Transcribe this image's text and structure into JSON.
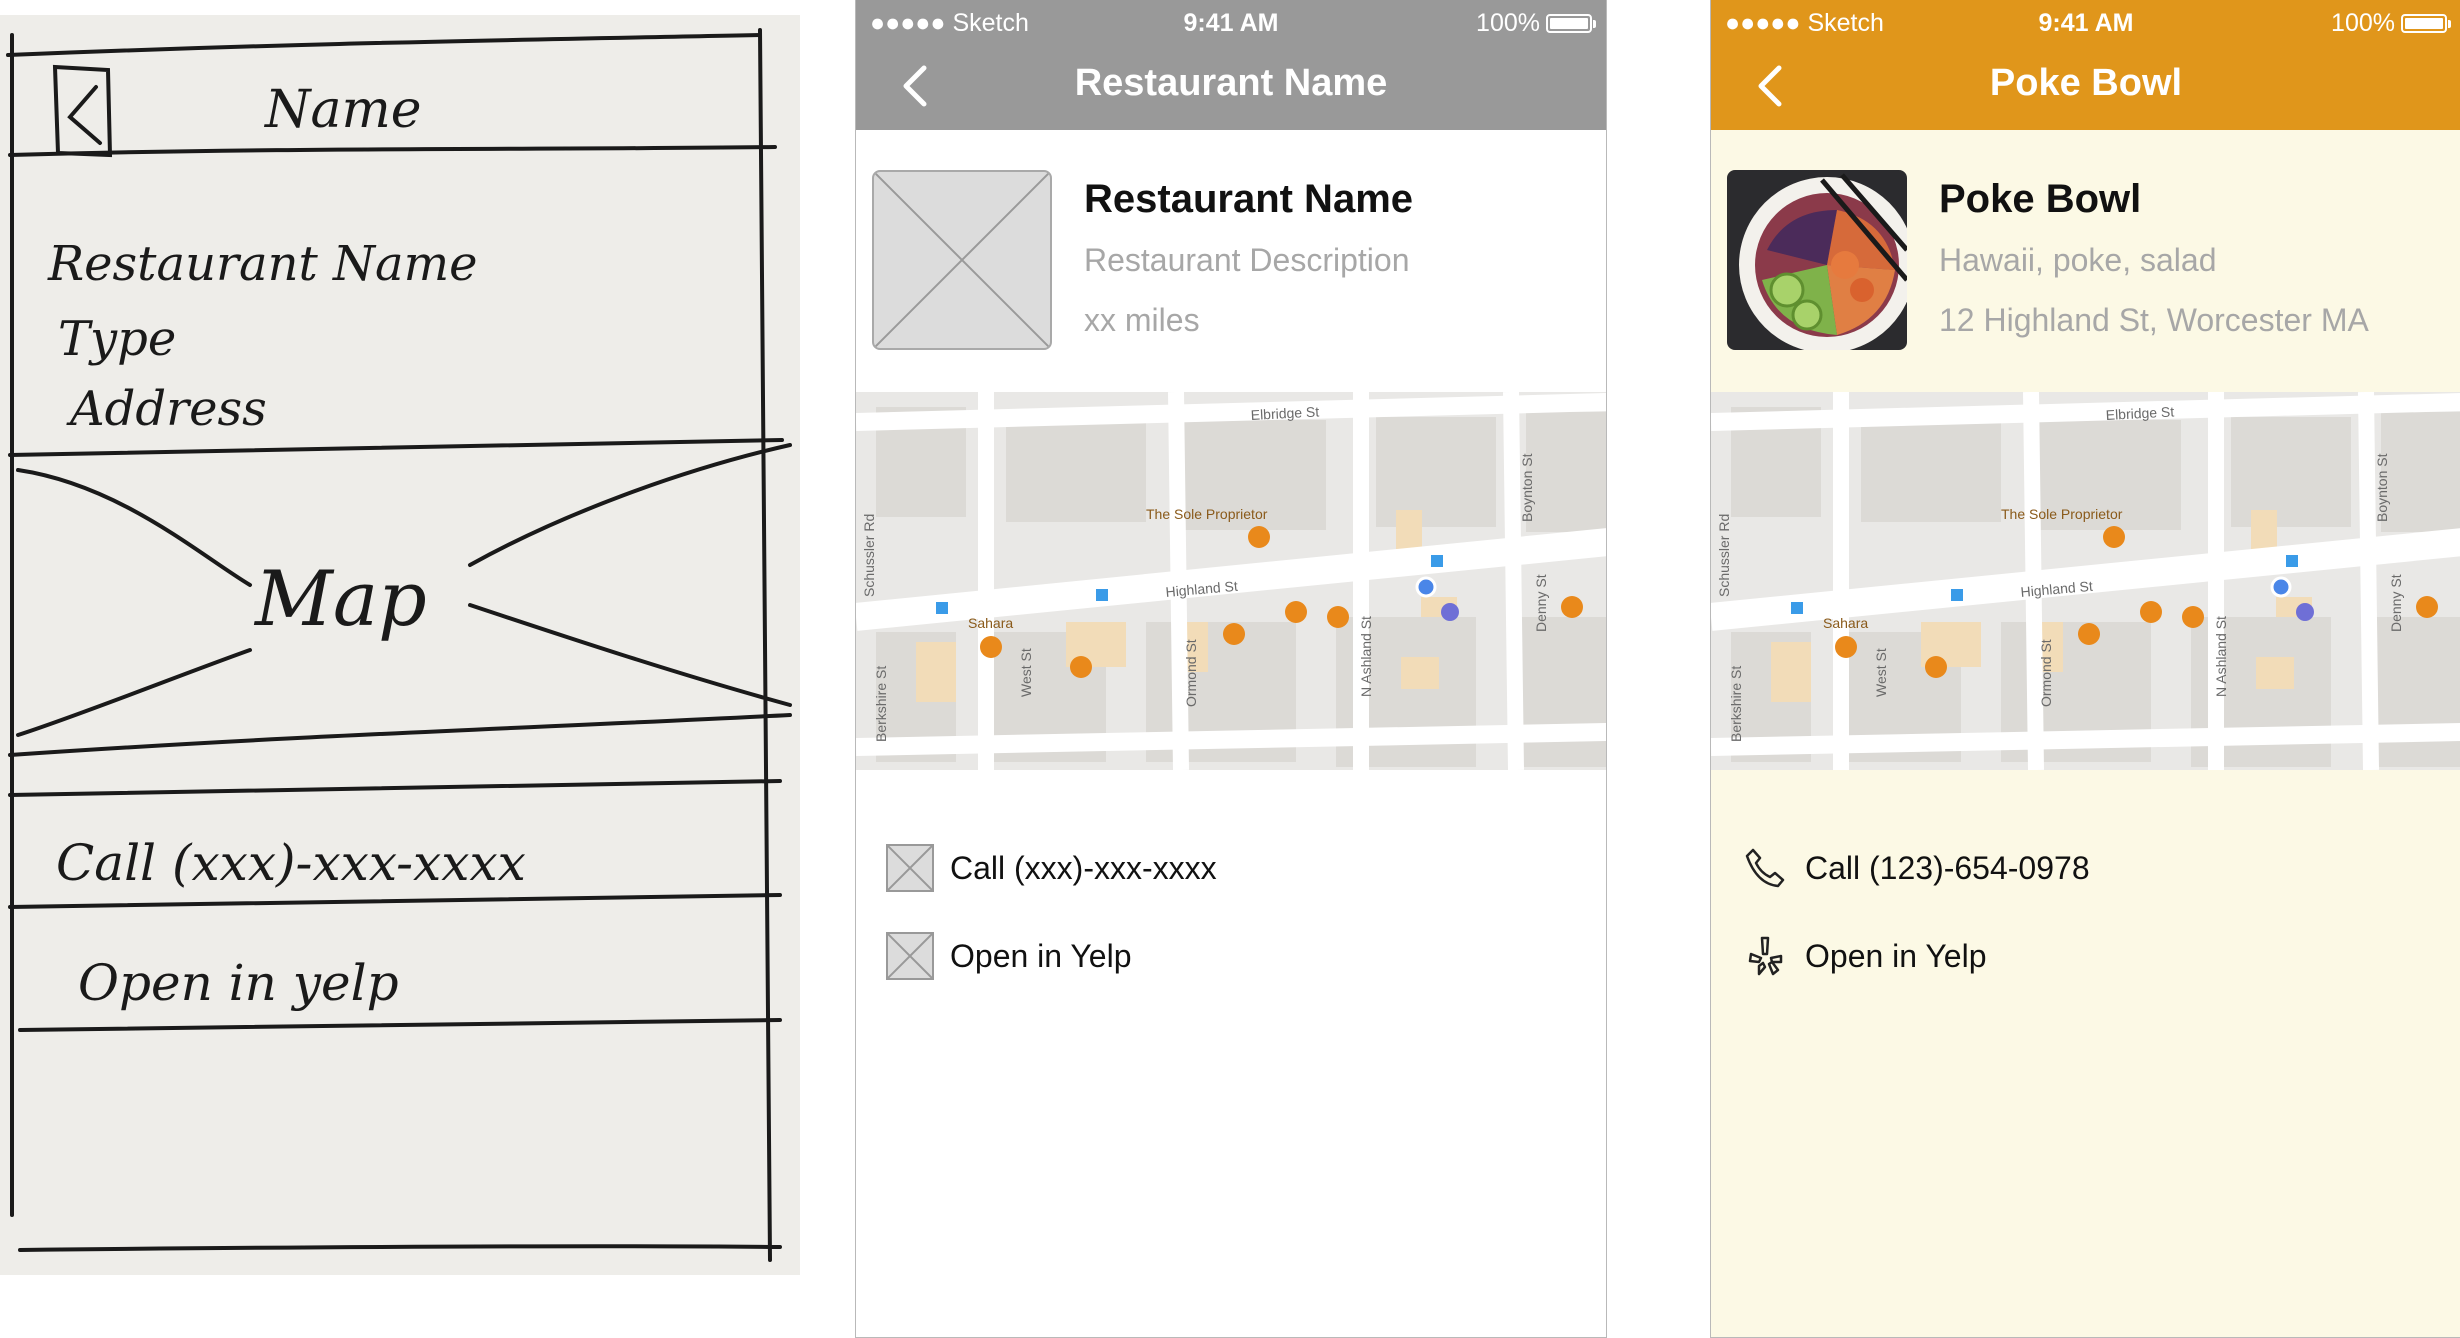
{
  "sketch": {
    "title": "Name",
    "header_lines": [
      "Restaurant Name",
      "Type",
      "Address"
    ],
    "map_label": "Map",
    "call_label": "Call (xxx)-xxx-xxxx",
    "yelp_label": "Open in yelp"
  },
  "wireframe": {
    "status": {
      "carrier": "●●●●● Sketch",
      "time": "9:41 AM",
      "battery": "100%"
    },
    "nav_title": "Restaurant Name",
    "name": "Restaurant Name",
    "description": "Restaurant Description",
    "distance": "xx miles",
    "call_label": "Call (xxx)-xxx-xxxx",
    "yelp_label": "Open in Yelp",
    "icons": {
      "back": "chevron-left-icon",
      "thumb": "image-placeholder-icon",
      "call": "placeholder-icon",
      "yelp": "placeholder-icon"
    },
    "colors": {
      "navbar": "#999999",
      "background": "#ffffff"
    }
  },
  "final": {
    "status": {
      "carrier": "●●●●● Sketch",
      "time": "9:41 AM",
      "battery": "100%"
    },
    "nav_title": "Poke Bowl",
    "name": "Poke Bowl",
    "tags": "Hawaii, poke, salad",
    "address": "12 Highland St, Worcester MA",
    "call_label": "Call (123)-654-0978",
    "yelp_label": "Open in Yelp",
    "icons": {
      "back": "chevron-left-icon",
      "call": "phone-icon",
      "yelp": "yelp-icon"
    },
    "colors": {
      "navbar": "#e0961b",
      "background": "#fcf9e5"
    }
  },
  "map": {
    "streets": [
      "Elbridge St",
      "Highland St",
      "Schussler Rd",
      "Boynton St",
      "Berkshire St",
      "West St",
      "Ormond St",
      "N Ashland St",
      "Denny St"
    ],
    "places": [
      "The Sole Proprietor",
      "Sahara"
    ]
  }
}
